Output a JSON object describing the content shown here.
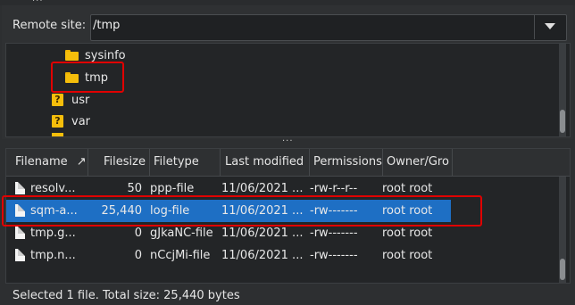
{
  "remote_site": {
    "label": "Remote site:",
    "path": "/tmp"
  },
  "tree": {
    "items": [
      {
        "label": "sysinfo",
        "icon": "folder-icon"
      },
      {
        "label": "tmp",
        "icon": "folder-icon",
        "highlighted": true
      },
      {
        "label": "usr",
        "icon": "unknown-folder-icon"
      },
      {
        "label": "var",
        "icon": "unknown-folder-icon"
      }
    ]
  },
  "file_list": {
    "columns": [
      "Filename",
      "Filesize",
      "Filetype",
      "Last modified",
      "Permissions",
      "Owner/Gro"
    ],
    "sort_indicator": "↗",
    "rows": [
      {
        "filename": "resolv...",
        "filesize": "50",
        "filetype": "ppp-file",
        "last_modified": "11/06/2021 ...",
        "permissions": "-rw-r--r--",
        "owner": "root root",
        "selected": false
      },
      {
        "filename": "sqm-a...",
        "filesize": "25,440",
        "filetype": "log-file",
        "last_modified": "11/06/2021 ...",
        "permissions": "-rw-------",
        "owner": "root root",
        "selected": true
      },
      {
        "filename": "tmp.g...",
        "filesize": "0",
        "filetype": "gJkaNC-file",
        "last_modified": "11/06/2021 ...",
        "permissions": "-rw-------",
        "owner": "root root",
        "selected": false
      },
      {
        "filename": "tmp.n...",
        "filesize": "0",
        "filetype": "nCcjMi-file",
        "last_modified": "11/06/2021 ...",
        "permissions": "-rw-------",
        "owner": "root root",
        "selected": false
      }
    ]
  },
  "status": {
    "text": "Selected 1 file. Total size: 25,440 bytes"
  },
  "colors": {
    "selection": "#1e6fc4",
    "highlight_box": "#e00000",
    "folder": "#f5be0b"
  }
}
